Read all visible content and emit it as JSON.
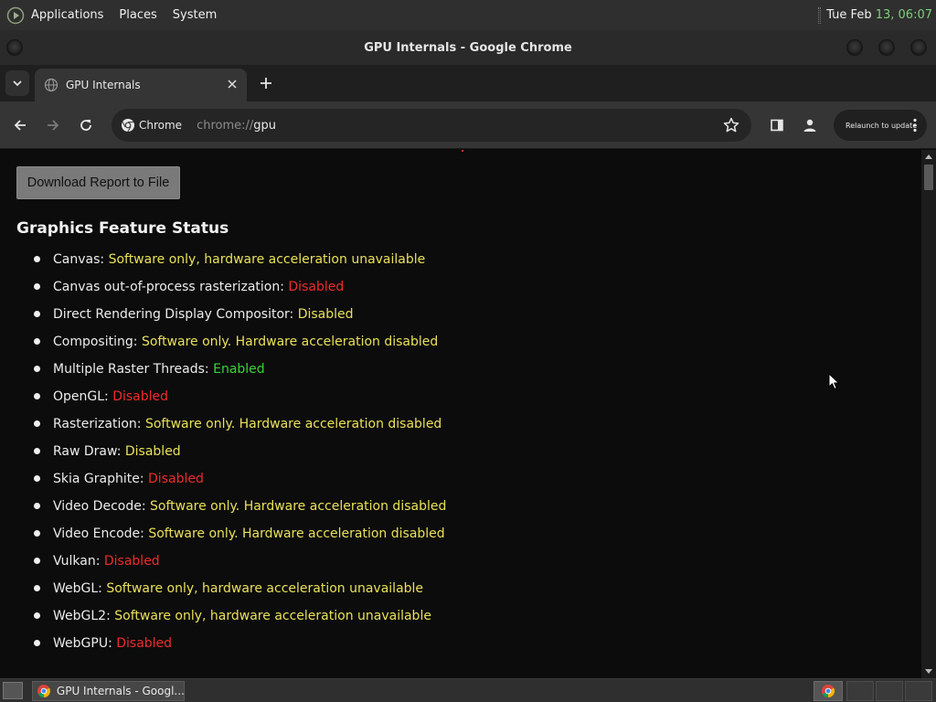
{
  "top_panel": {
    "menus": [
      "Applications",
      "Places",
      "System"
    ],
    "clock_prefix": "Tue Feb",
    "clock_highlight": "13, 06:07",
    "highlight_color": "#7ccf7c"
  },
  "window": {
    "title": "GPU Internals - Google Chrome"
  },
  "tabs": [
    {
      "title": "GPU Internals",
      "active": true
    }
  ],
  "toolbar": {
    "site_chip_label": "Chrome",
    "url_scheme": "chrome://",
    "url_host": "gpu",
    "relaunch_label": "Relaunch to update"
  },
  "page": {
    "download_button": "Download Report to File",
    "heading": "Graphics Feature Status",
    "features": [
      {
        "name": "Canvas",
        "status": "Software only, hardware acceleration unavailable",
        "color": "#e9e05a"
      },
      {
        "name": "Canvas out-of-process rasterization",
        "status": "Disabled",
        "color": "#ee2b2b"
      },
      {
        "name": "Direct Rendering Display Compositor",
        "status": "Disabled",
        "color": "#e9e05a"
      },
      {
        "name": "Compositing",
        "status": "Software only. Hardware acceleration disabled",
        "color": "#e9e05a"
      },
      {
        "name": "Multiple Raster Threads",
        "status": "Enabled",
        "color": "#37d437"
      },
      {
        "name": "OpenGL",
        "status": "Disabled",
        "color": "#ee2b2b"
      },
      {
        "name": "Rasterization",
        "status": "Software only. Hardware acceleration disabled",
        "color": "#e9e05a"
      },
      {
        "name": "Raw Draw",
        "status": "Disabled",
        "color": "#e9e05a"
      },
      {
        "name": "Skia Graphite",
        "status": "Disabled",
        "color": "#ee2b2b"
      },
      {
        "name": "Video Decode",
        "status": "Software only. Hardware acceleration disabled",
        "color": "#e9e05a"
      },
      {
        "name": "Video Encode",
        "status": "Software only. Hardware acceleration disabled",
        "color": "#e9e05a"
      },
      {
        "name": "Vulkan",
        "status": "Disabled",
        "color": "#ee2b2b"
      },
      {
        "name": "WebGL",
        "status": "Software only, hardware acceleration unavailable",
        "color": "#e9e05a"
      },
      {
        "name": "WebGL2",
        "status": "Software only, hardware acceleration unavailable",
        "color": "#e9e05a"
      },
      {
        "name": "WebGPU",
        "status": "Disabled",
        "color": "#ee2b2b"
      }
    ]
  },
  "taskbar": {
    "task_label": "GPU Internals - Googl..."
  }
}
